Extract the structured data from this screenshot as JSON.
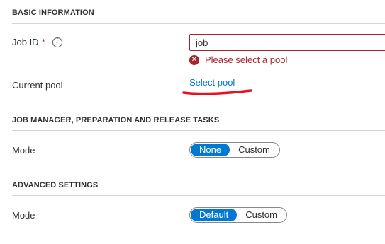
{
  "basic": {
    "header": "BASIC INFORMATION",
    "job_id": {
      "label": "Job ID",
      "required_marker": "*",
      "info_icon": "info-icon",
      "value": "job",
      "error": "Please select a pool",
      "error_icon": "error-circle-icon"
    },
    "current_pool": {
      "label": "Current pool",
      "link": "Select pool"
    }
  },
  "job_manager": {
    "header": "JOB MANAGER, PREPARATION AND RELEASE TASKS",
    "mode_label": "Mode",
    "options": [
      "None",
      "Custom"
    ],
    "selected": "None"
  },
  "advanced": {
    "header": "ADVANCED SETTINGS",
    "mode_label": "Mode",
    "options": [
      "Default",
      "Custom"
    ],
    "selected": "Default"
  },
  "colors": {
    "accent": "#0078d4",
    "error": "#a4262c",
    "annotation": "#e81123"
  }
}
